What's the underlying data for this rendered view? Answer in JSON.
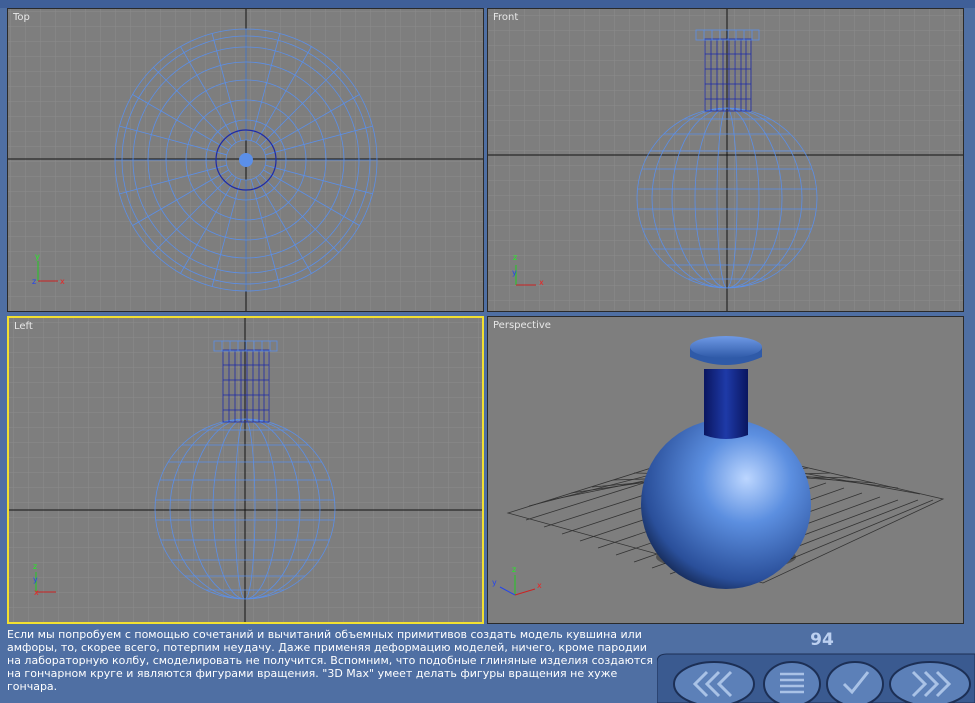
{
  "viewports": {
    "top": {
      "label": "Top"
    },
    "front": {
      "label": "Front"
    },
    "left": {
      "label": "Left"
    },
    "perspective": {
      "label": "Perspective"
    }
  },
  "axes": {
    "x": "x",
    "y": "y",
    "z": "z"
  },
  "description": "Если мы попробуем с помощью сочетаний и вычитаний объемных примитивов создать модель кувшина или амфоры, то, скорее всего, потерпим неудачу. Даже применяя деформацию моделей, ничего, кроме пародии на лабораторную колбу, смоделировать не получится. Вспомним, что подобные глиняные изделия создаются на гончарном круге и являются фигурами вращения. \"3D Max\" умеет делать фигуры вращения не хуже гончара.",
  "page_number": "94",
  "nav": {
    "prev_icon": "double-chevron-left-icon",
    "contents_icon": "list-icon",
    "check_icon": "checkmark-icon",
    "next_icon": "double-chevron-right-icon"
  },
  "colors": {
    "viewport_bg": "#7e7e7e",
    "grid": "#8c8c8c",
    "wire": "#5b8fe8",
    "wire_dark": "#1d2aa8",
    "active_border": "#f2e030",
    "panel": "#4f6fa3"
  }
}
